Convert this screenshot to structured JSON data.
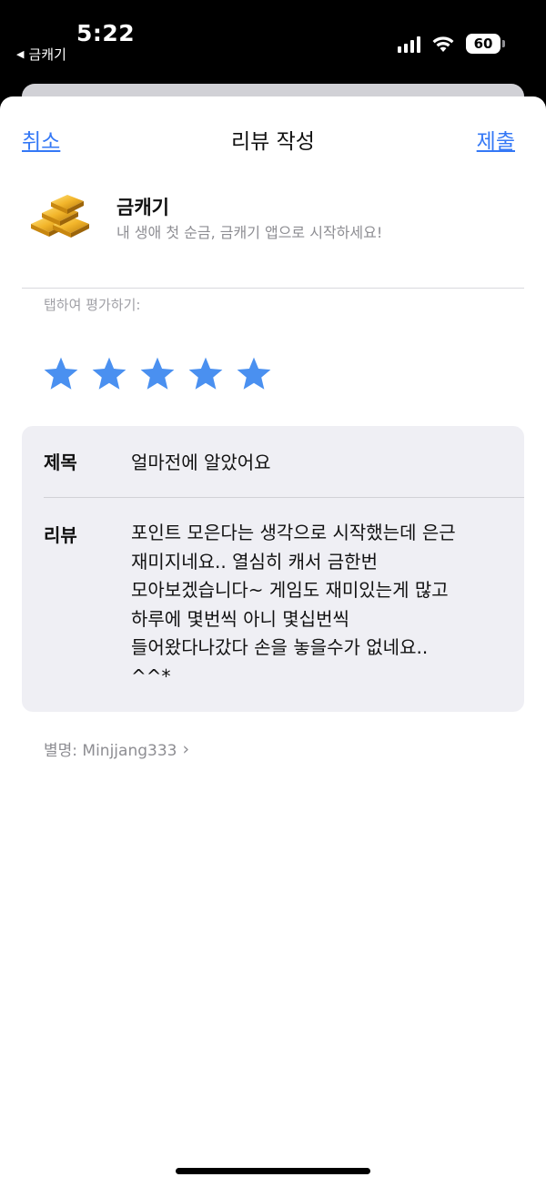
{
  "status_bar": {
    "time": "5:22",
    "back_app": "금캐기",
    "battery": "60",
    "icons": [
      "signal-icon",
      "wifi-icon",
      "battery-icon"
    ]
  },
  "nav": {
    "cancel_label": "취소",
    "title": "리뷰 작성",
    "submit_label": "제출"
  },
  "app": {
    "name": "금캐기",
    "subtitle": "내 생애 첫 순금, 금캐기 앱으로 시작하세요!",
    "icon": "gold-bars-icon"
  },
  "rating": {
    "prompt": "탭하여 평가하기:",
    "stars_selected": 5,
    "stars_total": 5,
    "star_color": "#4a90f0"
  },
  "form": {
    "title_label": "제목",
    "title_value": "얼마전에 알았어요",
    "review_label": "리뷰",
    "review_lines": [
      "포인트 모은다는 생각으로 시작했는데 은근",
      "재미지네요.. 열심히 캐서 금한번",
      "모아보겠습니다~ 게임도 재미있는게 많고",
      "하루에 몇번씩 아니 몇십번씩",
      "들어왔다나갔다 손을 놓을수가 없네요..",
      "^^*"
    ]
  },
  "nickname": "별명: Minjjang333",
  "colors": {
    "accent": "#3478f6",
    "card_bg": "#efeff4",
    "secondary_text": "#8e8e93"
  }
}
